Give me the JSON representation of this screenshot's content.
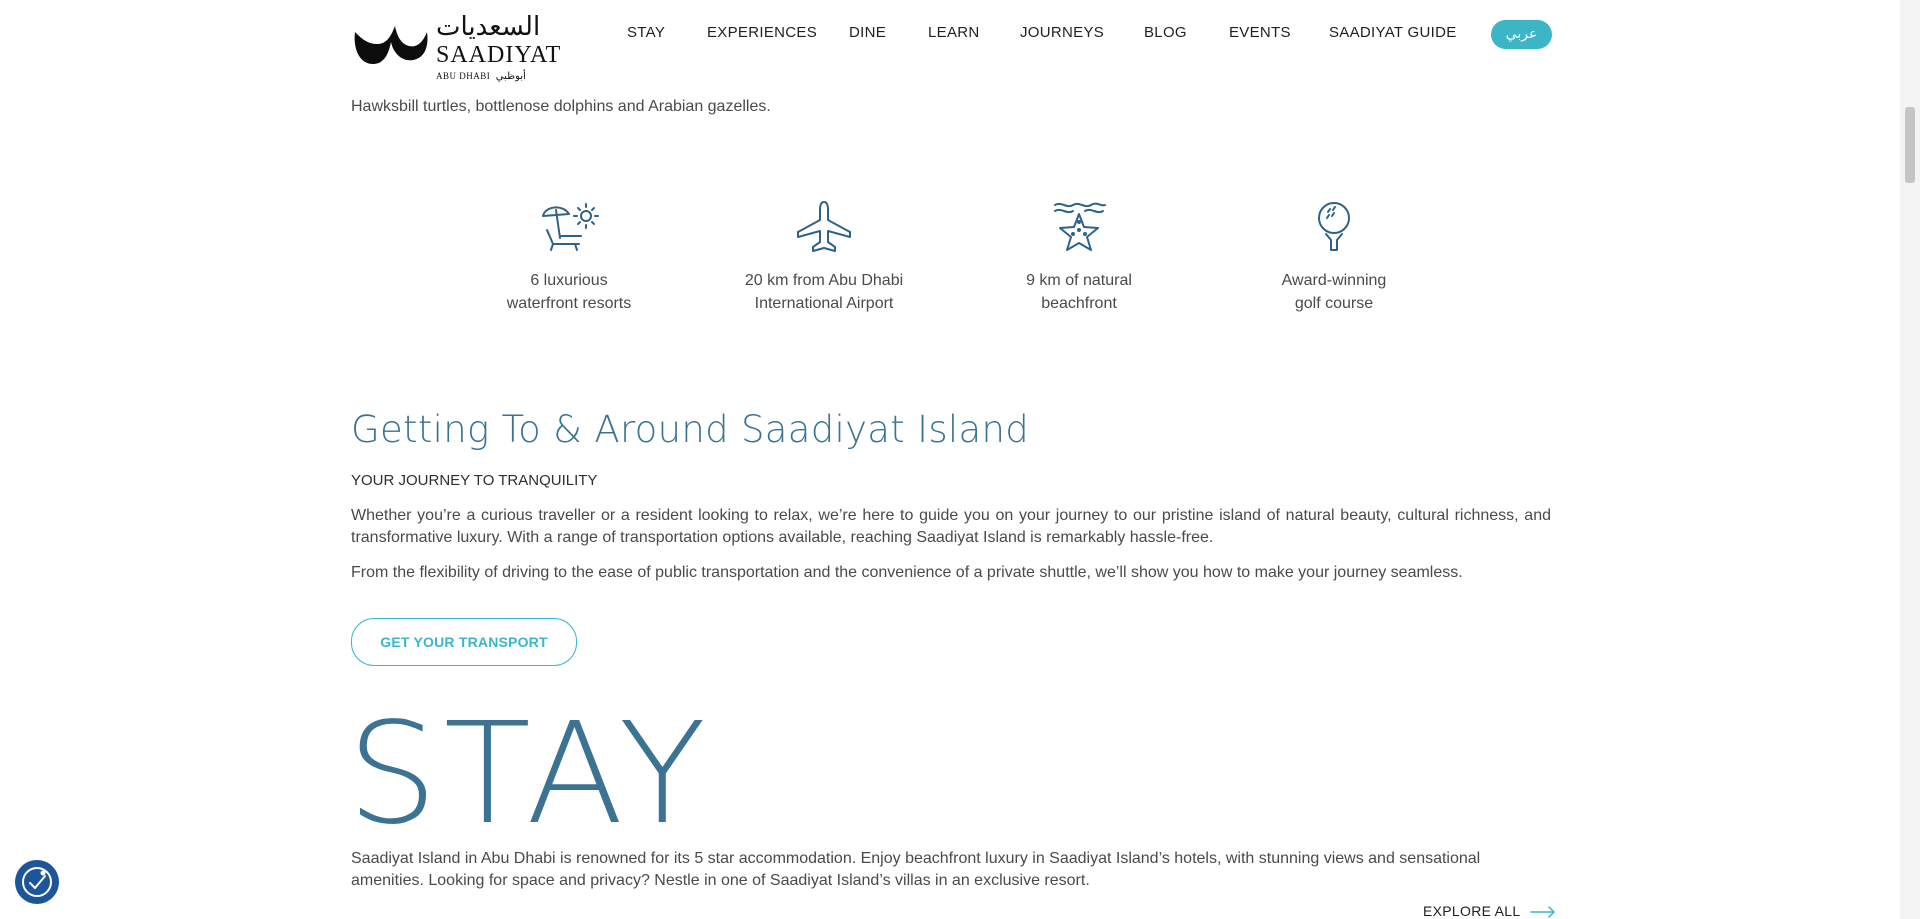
{
  "header": {
    "logo": {
      "arabic": "السعديات",
      "name": "SAADIYAT",
      "sub_left": "ABU DHABI",
      "sub_right": "أبوظبي"
    },
    "nav": [
      "STAY",
      "EXPERIENCES",
      "DINE",
      "LEARN",
      "JOURNEYS",
      "BLOG",
      "EVENTS",
      "SAADIYAT GUIDE"
    ],
    "lang_button": "عربي",
    "accent_color": "#3cb6c7"
  },
  "intro": {
    "text": "Hawksbill turtles, bottlenose dolphins and Arabian gazelles."
  },
  "features": [
    {
      "icon": "beach-chair-icon",
      "line1": "6 luxurious",
      "line2": "waterfront resorts"
    },
    {
      "icon": "airplane-icon",
      "line1": "20 km from Abu Dhabi",
      "line2": "International Airport"
    },
    {
      "icon": "starfish-icon",
      "line1": "9 km of natural",
      "line2": "beachfront"
    },
    {
      "icon": "golf-ball-icon",
      "line1": "Award-winning",
      "line2": "golf course"
    }
  ],
  "getting_around": {
    "title": "Getting To & Around Saadiyat Island",
    "subtitle": "YOUR JOURNEY TO TRANQUILITY",
    "para1": "Whether you’re a curious traveller or a resident looking to relax, we’re here to guide you on your journey to our pristine island of natural beauty, cultural richness, and transformative luxury. With a range of transportation options available, reaching Saadiyat Island is remarkably hassle-free.",
    "para2": "From the flexibility of driving to the ease of public transportation and the convenience of a private shuttle, we’ll show you how to make your journey seamless.",
    "button": "GET YOUR TRANSPORT"
  },
  "stay": {
    "title": "STAY",
    "text": "Saadiyat Island in Abu Dhabi is renowned for its 5 star accommodation. Enjoy beachfront luxury in Saadiyat Island’s hotels, with stunning views and sensational amenities. Looking for space and privacy? Nestle in one of Saadiyat Island’s villas in an exclusive resort.",
    "explore": "EXPLORE ALL"
  },
  "colors": {
    "heading": "#3c7392",
    "accent": "#3cb6c7",
    "icon": "#2e6287",
    "accessibility": "#1d5599"
  }
}
